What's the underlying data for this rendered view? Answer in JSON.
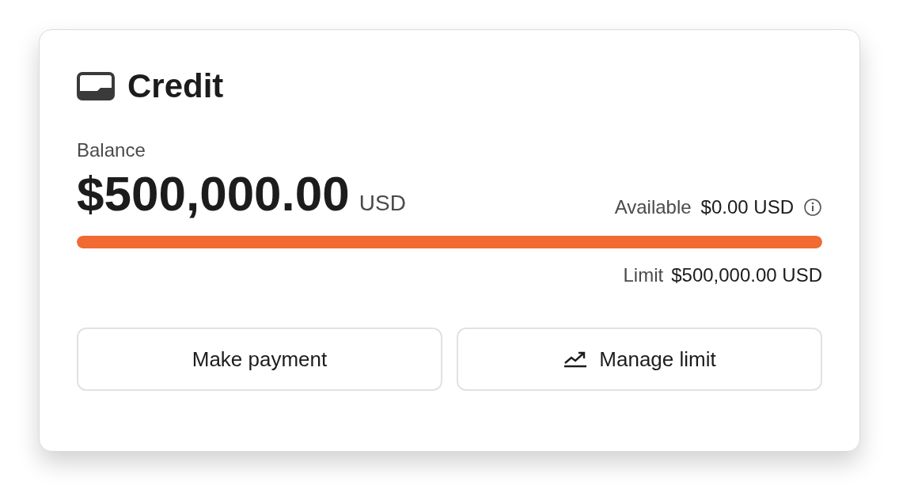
{
  "card": {
    "title": "Credit"
  },
  "balance": {
    "label": "Balance",
    "amount": "$500,000.00",
    "currency": "USD"
  },
  "available": {
    "label": "Available",
    "value": "$0.00 USD"
  },
  "usage_bar": {
    "level": 1
  },
  "limit": {
    "label": "Limit",
    "value": "$500,000.00 USD"
  },
  "buttons": [
    {
      "label": "Make payment",
      "kind": "plain"
    },
    {
      "label": "Manage limit",
      "kind": "trend"
    }
  ]
}
